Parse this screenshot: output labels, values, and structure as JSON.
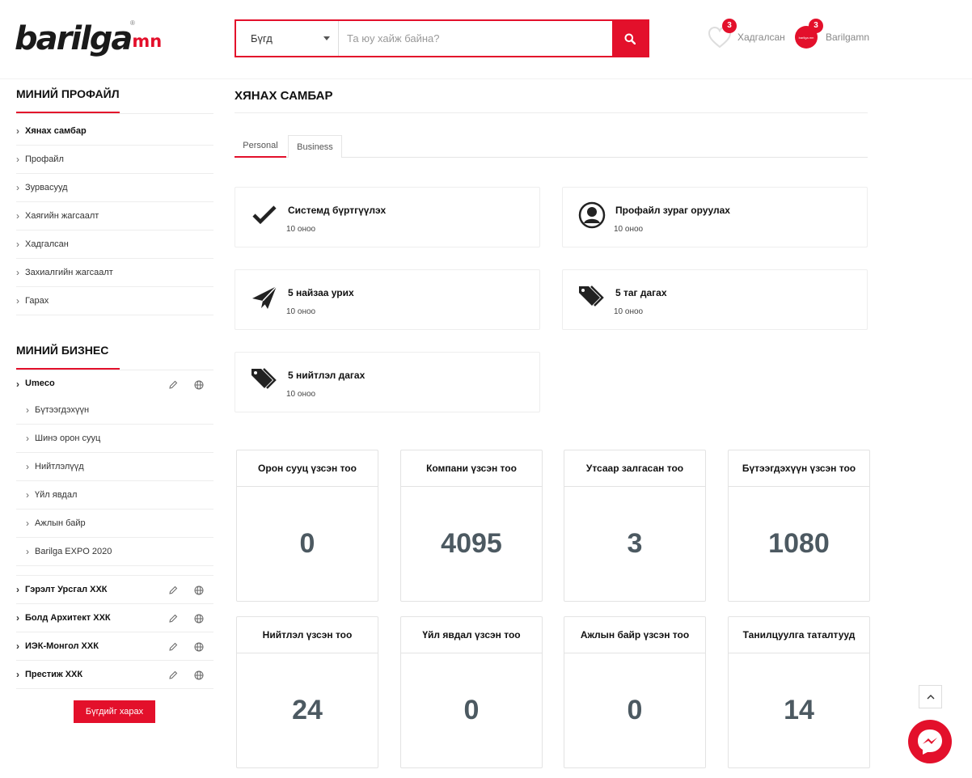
{
  "header": {
    "logo_main": "barilga",
    "logo_suffix": "mn",
    "logo_reg": "®",
    "search": {
      "category": "Бүгд",
      "placeholder": "Та юу хайж байна?"
    },
    "saved": {
      "label": "Хадгалсан",
      "count": "3"
    },
    "account": {
      "label": "Barilgamn",
      "count": "3",
      "avatar_text": "barilga.mn"
    }
  },
  "sidebar": {
    "profile_title": "МИНИЙ ПРОФАЙЛ",
    "profile_items": [
      {
        "label": "Хянах самбар"
      },
      {
        "label": "Профайл"
      },
      {
        "label": "Зурвасууд"
      },
      {
        "label": "Хаягийн жагсаалт"
      },
      {
        "label": "Хадгалсан"
      },
      {
        "label": "Захиалгийн жагсаалт"
      },
      {
        "label": "Гарах"
      }
    ],
    "business_title": "МИНИЙ БИЗНЕС",
    "businesses": [
      {
        "name": "Umeco",
        "sub": [
          "Бүтээгдэхүүн",
          "Шинэ орон сууц",
          "Нийтлэлүүд",
          "Үйл явдал",
          "Ажлын байр",
          "Barilga EXPO 2020"
        ]
      },
      {
        "name": "Гэрэлт Урсгал ХХК"
      },
      {
        "name": "Болд Архитект ХХК"
      },
      {
        "name": "ИЭК-Монгол ХХК"
      },
      {
        "name": "Престиж ХХК"
      }
    ],
    "see_all": "Бүгдийг харах"
  },
  "main": {
    "title": "ХЯНАХ САМБАР",
    "tabs": [
      {
        "label": "Personal"
      },
      {
        "label": "Business"
      }
    ],
    "tasks": [
      {
        "title": "Системд бүртгүүлэх",
        "points": "10 оноо",
        "icon": "check-icon"
      },
      {
        "title": "Профайл зураг оруулах",
        "points": "10 оноо",
        "icon": "user-circle-icon"
      },
      {
        "title": "5 найзаа урих",
        "points": "10 оноо",
        "icon": "paper-plane-icon"
      },
      {
        "title": "5 таг дагах",
        "points": "10 оноо",
        "icon": "tags-icon"
      },
      {
        "title": "5 нийтлэл дагах",
        "points": "10 оноо",
        "icon": "tags-icon"
      }
    ],
    "stats": [
      {
        "label": "Орон сууц үзсэн тоо",
        "value": "0"
      },
      {
        "label": "Компани үзсэн тоо",
        "value": "4095"
      },
      {
        "label": "Утсаар залгасан тоо",
        "value": "3"
      },
      {
        "label": "Бүтээгдэхүүн үзсэн тоо",
        "value": "1080"
      },
      {
        "label": "Нийтлэл үзсэн тоо",
        "value": "24"
      },
      {
        "label": "Үйл явдал үзсэн тоо",
        "value": "0"
      },
      {
        "label": "Ажлын байр үзсэн тоо",
        "value": "0"
      },
      {
        "label": "Танилцуулга таталтууд",
        "value": "14"
      }
    ]
  },
  "colors": {
    "accent": "#e3102b",
    "stat_value": "#4c5961"
  }
}
